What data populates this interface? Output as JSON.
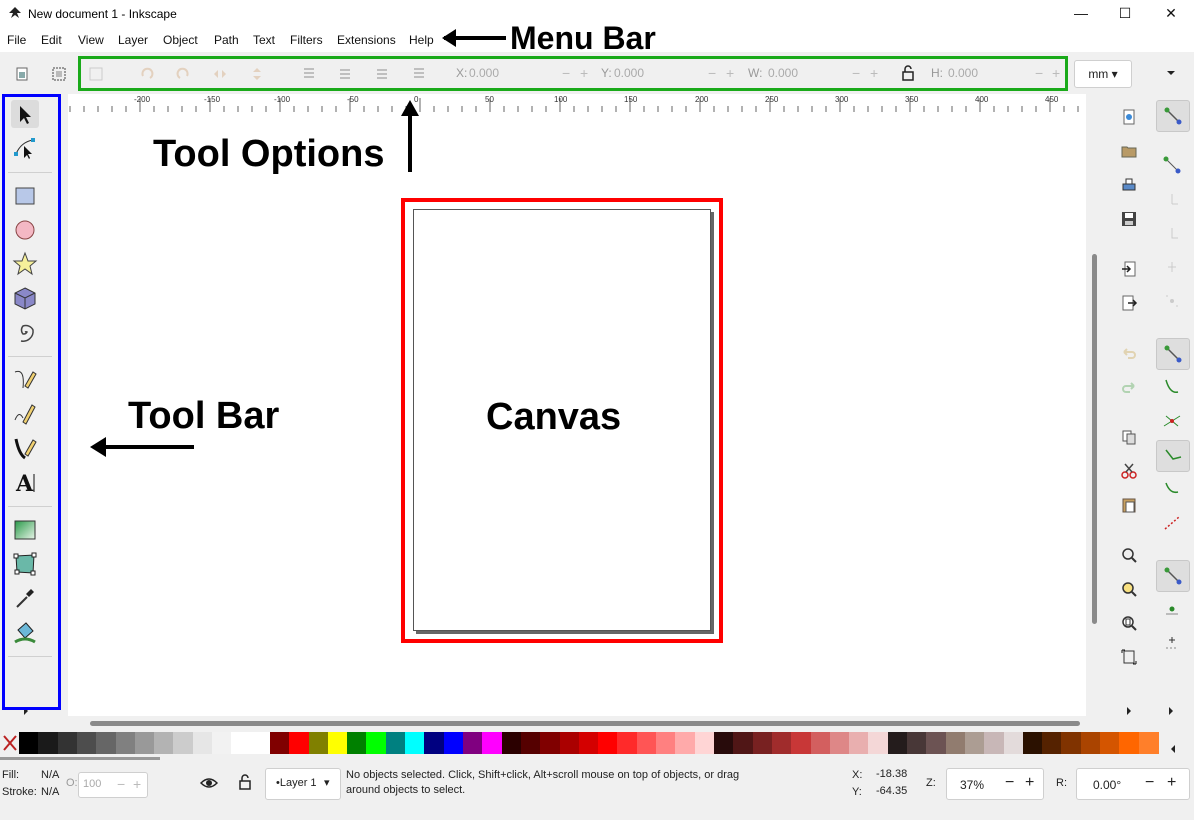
{
  "window": {
    "title": "New document 1 - Inkscape",
    "controls": [
      "—",
      "☐",
      "✕"
    ]
  },
  "menu": [
    "File",
    "Edit",
    "View",
    "Layer",
    "Object",
    "Path",
    "Text",
    "Filters",
    "Extensions",
    "Help"
  ],
  "tool_options": {
    "x_label": "X:",
    "x_value": "0.000",
    "y_label": "Y:",
    "y_value": "0.000",
    "w_label": "W:",
    "w_value": "0.000",
    "h_label": "H:",
    "h_value": "0.000",
    "unit": "mm"
  },
  "ruler_ticks": [
    "-200",
    "-150",
    "-100",
    "-50",
    "0",
    "50",
    "100",
    "150",
    "200",
    "250",
    "300",
    "350",
    "400",
    "450"
  ],
  "tools": [
    "selector-tool",
    "node-tool",
    "rectangle-tool",
    "ellipse-tool",
    "star-tool",
    "3d-box-tool",
    "spiral-tool",
    "pen-tool",
    "pencil-tool",
    "calligraphy-tool",
    "text-tool",
    "gradient-tool",
    "mesh-tool",
    "dropper-tool",
    "paint-bucket-tool"
  ],
  "palette_colors": [
    "#000000",
    "#1a1a1a",
    "#333333",
    "#4d4d4d",
    "#666666",
    "#808080",
    "#999999",
    "#b3b3b3",
    "#cccccc",
    "#e6e6e6",
    "#f2f2f2",
    "#ffffff",
    "#ffffff",
    "#800000",
    "#ff0000",
    "#808000",
    "#ffff00",
    "#008000",
    "#00ff00",
    "#008080",
    "#00ffff",
    "#000080",
    "#0000ff",
    "#800080",
    "#ff00ff",
    "#2b0000",
    "#550000",
    "#800000",
    "#aa0000",
    "#d40000",
    "#ff0000",
    "#ff2a2a",
    "#ff5555",
    "#ff8080",
    "#ffaaaa",
    "#ffd5d5",
    "#280b0b",
    "#501616",
    "#782121",
    "#a02c2c",
    "#c83737",
    "#d35f5f",
    "#de8787",
    "#e9afaf",
    "#f4d7d7",
    "#241c1c",
    "#483737",
    "#6c5353",
    "#917c6f",
    "#ac9d93",
    "#c8b7b7",
    "#e3dbdb",
    "#2b1100",
    "#552200",
    "#803300",
    "#aa4400",
    "#d45500",
    "#ff6600",
    "#ff7f2a"
  ],
  "status": {
    "fill_label": "Fill:",
    "fill_value": "N/A",
    "stroke_label": "Stroke:",
    "stroke_value": "N/A",
    "opacity_label": "O:",
    "opacity_value": "100",
    "layer": "•Layer 1",
    "message_line1": "No objects selected. Click, Shift+click, Alt+scroll mouse on top of objects, or drag",
    "message_line2": "around objects to select.",
    "x_label": "X:",
    "x_value": "-18.38",
    "y_label": "Y:",
    "y_value": "-64.35",
    "zoom_label": "Z:",
    "zoom_value": "37%",
    "rotate_label": "R:",
    "rotate_value": "0.00°"
  },
  "annotations": {
    "menu_bar": "Menu Bar",
    "tool_options": "Tool Options",
    "tool_bar": "Tool Bar",
    "canvas": "Canvas"
  },
  "colors": {
    "menu_highlight": "#000000",
    "tool_options_highlight": "#1aaa1a",
    "tool_bar_highlight": "#0000ff",
    "canvas_highlight": "#ff0000"
  }
}
